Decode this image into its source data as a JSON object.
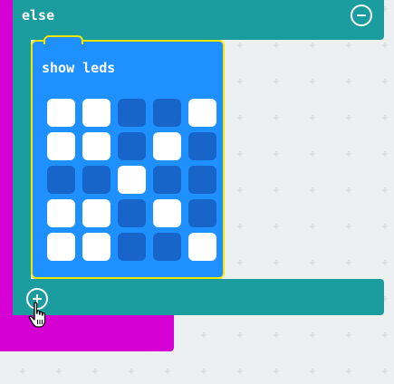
{
  "else_block": {
    "label": "else",
    "remove_icon": "minus-circle-icon",
    "add_icon": "plus-circle-icon",
    "color": "#1b9c9f"
  },
  "parent_block": {
    "color": "#d400d4"
  },
  "show_leds": {
    "title": "show leds",
    "color": "#1e90ff",
    "selected_outline": "#f5e600",
    "grid": [
      [
        1,
        1,
        0,
        0,
        1
      ],
      [
        1,
        1,
        0,
        1,
        0
      ],
      [
        0,
        0,
        1,
        0,
        0
      ],
      [
        1,
        1,
        0,
        1,
        0
      ],
      [
        1,
        1,
        0,
        0,
        1
      ]
    ]
  },
  "cursor": "hand-pointer-icon"
}
